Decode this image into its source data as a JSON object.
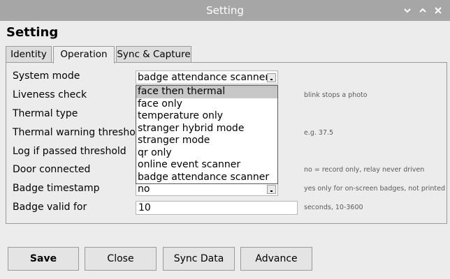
{
  "window": {
    "title": "Setting"
  },
  "heading": "Setting",
  "tabs": [
    {
      "label": "Identity",
      "active": false
    },
    {
      "label": "Operation",
      "active": true
    },
    {
      "label": "Sync & Capture",
      "active": false
    }
  ],
  "form": {
    "system_mode": {
      "label": "System mode",
      "value": "badge attendance scanner"
    },
    "liveness_check": {
      "label": "Liveness check",
      "hint": "blink stops a photo"
    },
    "thermal_type": {
      "label": "Thermal type"
    },
    "thermal_warning_threshold": {
      "label": "Thermal warning threshold",
      "hint": "e.g. 37.5"
    },
    "log_if_passed_threshold": {
      "label": "Log if passed threshold"
    },
    "door_connected": {
      "label": "Door connected",
      "hint": "no = record only, relay never driven"
    },
    "badge_timestamp": {
      "label": "Badge timestamp",
      "value": "no",
      "hint": "yes only for on-screen badges, not printed"
    },
    "badge_valid_for": {
      "label": "Badge valid for",
      "value": "10",
      "hint": "seconds, 10-3600"
    }
  },
  "dropdown": {
    "options": [
      "face then thermal",
      "face only",
      "temperature only",
      "stranger hybrid mode",
      "stranger mode",
      "qr only",
      "online event scanner",
      "badge attendance scanner"
    ],
    "highlighted_index": 0
  },
  "buttons": {
    "save": "Save",
    "close": "Close",
    "sync_data": "Sync Data",
    "advance": "Advance"
  },
  "colors": {
    "titlebar": "#a6a6a6",
    "window_bg": "#ececec",
    "highlight": "#c7c7c7"
  },
  "icons": [
    "chevron-down-icon",
    "chevron-up-icon",
    "close-icon"
  ]
}
